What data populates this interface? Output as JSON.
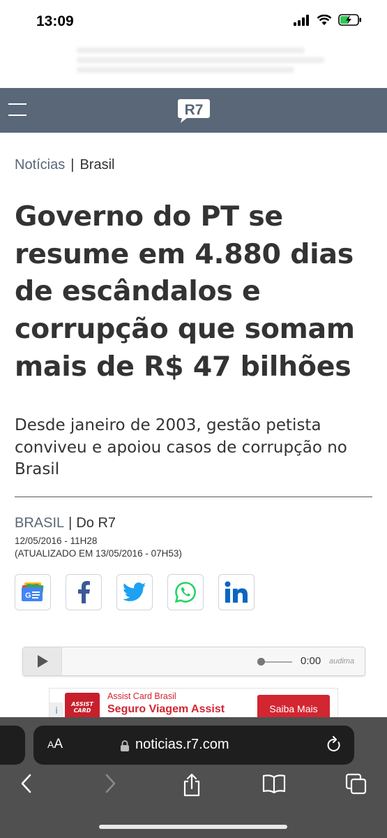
{
  "status_bar": {
    "time": "13:09"
  },
  "header": {
    "logo_text": "R7"
  },
  "breadcrumb": {
    "section": "Notícias",
    "separator": "|",
    "current": "Brasil"
  },
  "article": {
    "title": "Governo do PT se resume em 4.880 dias de escândalos e corrupção que somam mais de R$ 47 bilhões",
    "subtitle": "Desde janeiro de 2003, gestão petista conviveu e apoiou casos de corrupção no Brasil",
    "section": "BRASIL",
    "separator": "|",
    "source": "Do R7",
    "date": "12/05/2016 - 11H28",
    "updated": "(ATUALIZADO EM 13/05/2016 - 07H53)"
  },
  "share_buttons": [
    {
      "name": "google-news",
      "icon": "google-news-icon"
    },
    {
      "name": "facebook",
      "icon": "facebook-icon"
    },
    {
      "name": "twitter",
      "icon": "twitter-icon"
    },
    {
      "name": "whatsapp",
      "icon": "whatsapp-icon"
    },
    {
      "name": "linkedin",
      "icon": "linkedin-icon"
    }
  ],
  "audio": {
    "time": "0:00",
    "brand": "audima",
    "progress": 0
  },
  "ad": {
    "logo_text": "ASSIST CARD",
    "brand": "Assist Card Brasil",
    "headline": "Seguro Viagem Assist",
    "cta": "Saiba Mais",
    "info_icon": "i"
  },
  "safari": {
    "aa_label": "AA",
    "url": "noticias.r7.com"
  },
  "colors": {
    "header_bg": "#5a6779",
    "accent": "#5a6779",
    "ad_red": "#d22631",
    "facebook": "#3b5998",
    "twitter": "#1da1f2",
    "whatsapp": "#25d366",
    "linkedin": "#0a66c2"
  }
}
